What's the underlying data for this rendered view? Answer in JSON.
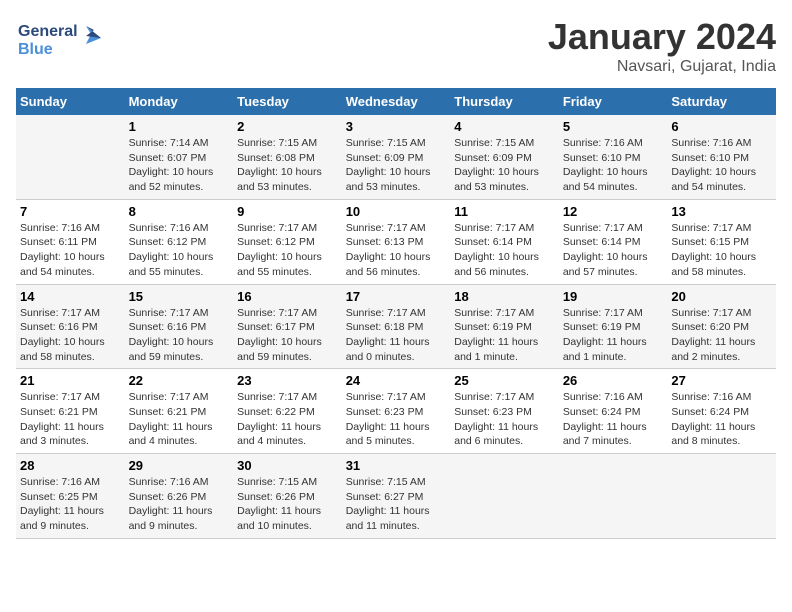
{
  "header": {
    "logo_general": "General",
    "logo_blue": "Blue",
    "title": "January 2024",
    "subtitle": "Navsari, Gujarat, India"
  },
  "days_of_week": [
    "Sunday",
    "Monday",
    "Tuesday",
    "Wednesday",
    "Thursday",
    "Friday",
    "Saturday"
  ],
  "weeks": [
    [
      {
        "date": "",
        "info": ""
      },
      {
        "date": "1",
        "info": "Sunrise: 7:14 AM\nSunset: 6:07 PM\nDaylight: 10 hours\nand 52 minutes."
      },
      {
        "date": "2",
        "info": "Sunrise: 7:15 AM\nSunset: 6:08 PM\nDaylight: 10 hours\nand 53 minutes."
      },
      {
        "date": "3",
        "info": "Sunrise: 7:15 AM\nSunset: 6:09 PM\nDaylight: 10 hours\nand 53 minutes."
      },
      {
        "date": "4",
        "info": "Sunrise: 7:15 AM\nSunset: 6:09 PM\nDaylight: 10 hours\nand 53 minutes."
      },
      {
        "date": "5",
        "info": "Sunrise: 7:16 AM\nSunset: 6:10 PM\nDaylight: 10 hours\nand 54 minutes."
      },
      {
        "date": "6",
        "info": "Sunrise: 7:16 AM\nSunset: 6:10 PM\nDaylight: 10 hours\nand 54 minutes."
      }
    ],
    [
      {
        "date": "7",
        "info": "Sunrise: 7:16 AM\nSunset: 6:11 PM\nDaylight: 10 hours\nand 54 minutes."
      },
      {
        "date": "8",
        "info": "Sunrise: 7:16 AM\nSunset: 6:12 PM\nDaylight: 10 hours\nand 55 minutes."
      },
      {
        "date": "9",
        "info": "Sunrise: 7:17 AM\nSunset: 6:12 PM\nDaylight: 10 hours\nand 55 minutes."
      },
      {
        "date": "10",
        "info": "Sunrise: 7:17 AM\nSunset: 6:13 PM\nDaylight: 10 hours\nand 56 minutes."
      },
      {
        "date": "11",
        "info": "Sunrise: 7:17 AM\nSunset: 6:14 PM\nDaylight: 10 hours\nand 56 minutes."
      },
      {
        "date": "12",
        "info": "Sunrise: 7:17 AM\nSunset: 6:14 PM\nDaylight: 10 hours\nand 57 minutes."
      },
      {
        "date": "13",
        "info": "Sunrise: 7:17 AM\nSunset: 6:15 PM\nDaylight: 10 hours\nand 58 minutes."
      }
    ],
    [
      {
        "date": "14",
        "info": "Sunrise: 7:17 AM\nSunset: 6:16 PM\nDaylight: 10 hours\nand 58 minutes."
      },
      {
        "date": "15",
        "info": "Sunrise: 7:17 AM\nSunset: 6:16 PM\nDaylight: 10 hours\nand 59 minutes."
      },
      {
        "date": "16",
        "info": "Sunrise: 7:17 AM\nSunset: 6:17 PM\nDaylight: 10 hours\nand 59 minutes."
      },
      {
        "date": "17",
        "info": "Sunrise: 7:17 AM\nSunset: 6:18 PM\nDaylight: 11 hours\nand 0 minutes."
      },
      {
        "date": "18",
        "info": "Sunrise: 7:17 AM\nSunset: 6:19 PM\nDaylight: 11 hours\nand 1 minute."
      },
      {
        "date": "19",
        "info": "Sunrise: 7:17 AM\nSunset: 6:19 PM\nDaylight: 11 hours\nand 1 minute."
      },
      {
        "date": "20",
        "info": "Sunrise: 7:17 AM\nSunset: 6:20 PM\nDaylight: 11 hours\nand 2 minutes."
      }
    ],
    [
      {
        "date": "21",
        "info": "Sunrise: 7:17 AM\nSunset: 6:21 PM\nDaylight: 11 hours\nand 3 minutes."
      },
      {
        "date": "22",
        "info": "Sunrise: 7:17 AM\nSunset: 6:21 PM\nDaylight: 11 hours\nand 4 minutes."
      },
      {
        "date": "23",
        "info": "Sunrise: 7:17 AM\nSunset: 6:22 PM\nDaylight: 11 hours\nand 4 minutes."
      },
      {
        "date": "24",
        "info": "Sunrise: 7:17 AM\nSunset: 6:23 PM\nDaylight: 11 hours\nand 5 minutes."
      },
      {
        "date": "25",
        "info": "Sunrise: 7:17 AM\nSunset: 6:23 PM\nDaylight: 11 hours\nand 6 minutes."
      },
      {
        "date": "26",
        "info": "Sunrise: 7:16 AM\nSunset: 6:24 PM\nDaylight: 11 hours\nand 7 minutes."
      },
      {
        "date": "27",
        "info": "Sunrise: 7:16 AM\nSunset: 6:24 PM\nDaylight: 11 hours\nand 8 minutes."
      }
    ],
    [
      {
        "date": "28",
        "info": "Sunrise: 7:16 AM\nSunset: 6:25 PM\nDaylight: 11 hours\nand 9 minutes."
      },
      {
        "date": "29",
        "info": "Sunrise: 7:16 AM\nSunset: 6:26 PM\nDaylight: 11 hours\nand 9 minutes."
      },
      {
        "date": "30",
        "info": "Sunrise: 7:15 AM\nSunset: 6:26 PM\nDaylight: 11 hours\nand 10 minutes."
      },
      {
        "date": "31",
        "info": "Sunrise: 7:15 AM\nSunset: 6:27 PM\nDaylight: 11 hours\nand 11 minutes."
      },
      {
        "date": "",
        "info": ""
      },
      {
        "date": "",
        "info": ""
      },
      {
        "date": "",
        "info": ""
      }
    ]
  ]
}
